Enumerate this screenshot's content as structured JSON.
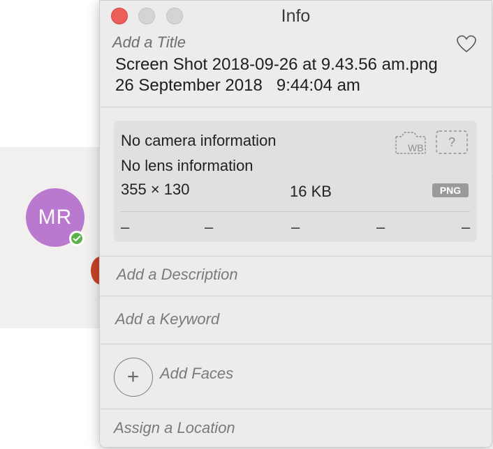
{
  "background": {
    "avatar_initials": "MR",
    "colors": {
      "avatar": "#b979cf",
      "presence": "#5cb24a"
    }
  },
  "window": {
    "title": "Info",
    "controls": [
      "close",
      "minimize",
      "zoom"
    ],
    "colors": {
      "close": "#ec5f59",
      "inactive": "#d4d4d4"
    }
  },
  "photo": {
    "title_placeholder": "Add a Title",
    "filename": "Screen Shot 2018-09-26 at 9.43.56 am.png",
    "date": "26 September 2018",
    "time": "9:44:04 am",
    "favorite_icon": "heart-icon"
  },
  "camera": {
    "camera_info": "No camera information",
    "lens_info": "No lens information",
    "dimensions": "355 × 130",
    "file_size": "16 KB",
    "format_badge": "PNG",
    "wb_icon": "camera-wb-icon",
    "unknown_icon": "question-frame-icon",
    "wb_label": "WB",
    "unknown_label": "?",
    "exposure_values": [
      "–",
      "–",
      "–",
      "–",
      "–"
    ]
  },
  "fields": {
    "description_placeholder": "Add a Description",
    "keyword_placeholder": "Add a Keyword",
    "faces_label": "Add Faces",
    "faces_button_symbol": "+",
    "location_placeholder": "Assign a Location"
  }
}
